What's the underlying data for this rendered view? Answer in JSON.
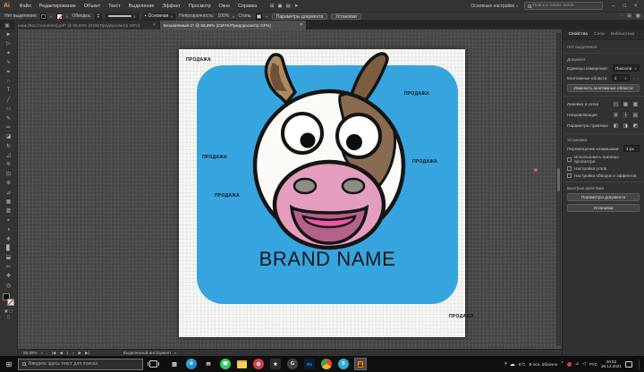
{
  "titlebar": {
    "logo": "Ai",
    "menus": [
      "Файл",
      "Редактирование",
      "Объект",
      "Текст",
      "Выделение",
      "Эффект",
      "Просмотр",
      "Окно",
      "Справка"
    ],
    "workspace_button": "Основные настройки",
    "stock_search_placeholder": "Поиск в Adobe Stock",
    "minimize": "–",
    "restore": "□",
    "close": "×"
  },
  "options_bar": {
    "selection_status": "Нет выделения",
    "stroke_label": "Обводка:",
    "brush_value": "Основная",
    "opacity_label": "Непрозрачность:",
    "opacity_value": "100%",
    "style_label": "Стиль:",
    "doc_setup_button": "Параметры документа",
    "preferences_button": "Установки"
  },
  "doc_tabs": {
    "tab1": "нник [Восстановлен].pdf* @ 96,93% (RGB/Предпросмотр GPU)",
    "tab2": "Безымянный-1* @ 66,89% (CMYK/Предпросмотр GPU)",
    "close_glyph": "×"
  },
  "toolbar": {
    "tools": [
      {
        "name": "selection-tool",
        "glyph": "►"
      },
      {
        "name": "direct-selection-tool",
        "glyph": "▷"
      },
      {
        "name": "magic-wand-tool",
        "glyph": "✶"
      },
      {
        "name": "lasso-tool",
        "glyph": "∿"
      },
      {
        "name": "pen-tool",
        "glyph": "✒"
      },
      {
        "name": "curvature-tool",
        "glyph": "∩"
      },
      {
        "name": "type-tool",
        "glyph": "T"
      },
      {
        "name": "line-segment-tool",
        "glyph": "╱"
      },
      {
        "name": "rectangle-tool",
        "glyph": "▭"
      },
      {
        "name": "paintbrush-tool",
        "glyph": "✎"
      },
      {
        "name": "pencil-tool",
        "glyph": "✏"
      },
      {
        "name": "eraser-tool",
        "glyph": "◪"
      },
      {
        "name": "rotate-tool",
        "glyph": "↻"
      },
      {
        "name": "scale-tool",
        "glyph": "◿"
      },
      {
        "name": "width-tool",
        "glyph": "≋"
      },
      {
        "name": "free-transform-tool",
        "glyph": "⊡"
      },
      {
        "name": "shape-builder-tool",
        "glyph": "⊕"
      },
      {
        "name": "perspective-grid-tool",
        "glyph": "⊿"
      },
      {
        "name": "mesh-tool",
        "glyph": "▦"
      },
      {
        "name": "gradient-tool",
        "glyph": "▥"
      },
      {
        "name": "eyedropper-tool",
        "glyph": "⌖"
      },
      {
        "name": "blend-tool",
        "glyph": "◑"
      },
      {
        "name": "symbol-sprayer-tool",
        "glyph": "❉"
      },
      {
        "name": "graph-tool",
        "glyph": "▊"
      },
      {
        "name": "artboard-tool",
        "glyph": "⬓"
      },
      {
        "name": "slice-tool",
        "glyph": "✂"
      },
      {
        "name": "hand-tool",
        "glyph": "✥"
      },
      {
        "name": "zoom-tool",
        "glyph": "◎"
      }
    ]
  },
  "canvas": {
    "artboard": {
      "sale_label": "ПРОДАЖА",
      "brand_name": "BRAND NAME",
      "card_color": "#36A5DF"
    },
    "cow": {
      "head": "#FBFAF7",
      "outline": "#141414",
      "patch": "#8A6A50",
      "horn_left": "#AB8A61",
      "horn_left_inner": "#6E5139",
      "horn_right": "#7E5C3F",
      "eye_white": "#FFFFFF",
      "pupil": "#0d0d0d",
      "muzzle": "#E59DBE",
      "nostril": "#8D8D85",
      "mouth": "#B5618A",
      "tongue": "#F155A3"
    }
  },
  "status_bar": {
    "zoom_value": "66,89%",
    "artboard_number": "1",
    "tool_status": "Выделенный инструмент"
  },
  "right_panel": {
    "tabs": {
      "properties": "Свойства",
      "layers": "Слои",
      "libraries": "Библиотеки"
    },
    "no_selection": "Нет выделения",
    "document_section": "Документ",
    "units_label": "Единицы измерения:",
    "units_value": "Пиксели",
    "artboards_label": "Монтажные области:",
    "artboards_value": "1",
    "edit_artboards_button": "Изменить монтажные области",
    "rulers_grids_label": "Линейка и сетки",
    "guides_label": "Направляющие",
    "snap_options_label": "Параметры привязки",
    "preferences_section": "Установки",
    "keyboard_increment_label": "Перемещение клавишами:",
    "keyboard_increment_value": "1 px",
    "checkbox_preview_bounds": "Использовать границы просмотра",
    "checkbox_corners": "Настройка углов",
    "checkbox_strokes_effects": "Настройка обводок и эффектов",
    "quick_actions_section": "Быстрые действия",
    "doc_setup_button": "Параметры документа",
    "preferences_button": "Установки"
  },
  "taskbar": {
    "search_placeholder": "Введите здесь текст для поиска",
    "apps": [
      {
        "name": "taskbar-app-store",
        "glyph": "▥",
        "css": "color:#f0f0f0;"
      },
      {
        "name": "taskbar-app-edge",
        "glyph": "e",
        "css": "color:#fff;background:linear-gradient(135deg,#35c5cd,#1f6fd8);border-radius:50%;"
      },
      {
        "name": "taskbar-app-mail",
        "glyph": "✉",
        "css": "color:#e8e8e8;"
      },
      {
        "name": "taskbar-app-whatsapp",
        "glyph": "☎",
        "css": "color:#fff;background:#2BD163;border-radius:50%;font-size:5px;"
      },
      {
        "name": "taskbar-app-explorer",
        "glyph": "",
        "css": "background:#F8CF5A;border-radius:1px;width:11px;height:9px;border-top:2px solid #e3b83e;"
      },
      {
        "name": "taskbar-app-browser-red",
        "glyph": "",
        "css": "background:radial-gradient(circle,#aaccff 0 26%,#e23b3b 30%);border-radius:50%;"
      },
      {
        "name": "taskbar-app-star",
        "glyph": "★",
        "css": "color:#e6e6e6;background:#2c2c2c;border-radius:2px;font-size:6px;"
      },
      {
        "name": "taskbar-app-g",
        "glyph": "G",
        "css": "color:#f0f0f0;background:#444;border-radius:50%;font-size:5.5px;"
      },
      {
        "name": "taskbar-app-photoshop",
        "glyph": "Ps",
        "css": "color:#34a8ff;background:#0b1e33;font-size:4.5px;border-radius:1px;"
      },
      {
        "name": "taskbar-app-chrome",
        "glyph": "●",
        "css": "background:conic-gradient(#ea4335 0 33%,#fbbc05 0 66%,#34a853 0 100%);border-radius:50%;color:#8ab4f8;font-size:4.5px;"
      },
      {
        "name": "taskbar-app-skype",
        "glyph": "S",
        "css": "color:#fff;background:#33aadd;border-radius:50%;font-size:5.5px;"
      }
    ],
    "illustrator_app": {
      "glyph": "Ai",
      "css": "color:#ff9a00;background:#2d1400;border:1px solid #ff9a00;font-size:4.8px;border-radius:1px;"
    },
    "tray": {
      "weather_temp": "5°C",
      "weather_text": "В осн. облачно",
      "hidden_icons": "^",
      "language": "РУС",
      "time": "20:52",
      "date": "28.12.2021"
    }
  }
}
